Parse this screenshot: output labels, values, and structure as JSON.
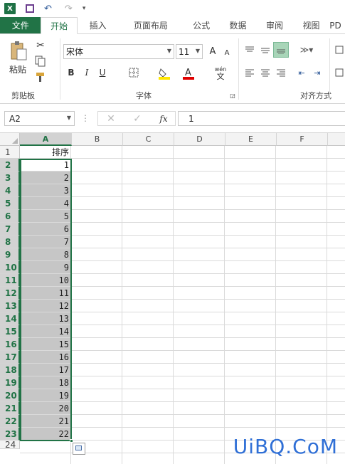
{
  "quick_access": {
    "undo_glyph": "↶",
    "redo_glyph": "↷",
    "more_glyph": "▾"
  },
  "tabs": [
    {
      "label": "文件"
    },
    {
      "label": "开始"
    },
    {
      "label": "插入"
    },
    {
      "label": "页面布局"
    },
    {
      "label": "公式"
    },
    {
      "label": "数据"
    },
    {
      "label": "审阅"
    },
    {
      "label": "视图"
    },
    {
      "label": "PD"
    }
  ],
  "ribbon": {
    "clipboard": {
      "paste_label": "粘贴",
      "group_label": "剪贴板"
    },
    "font": {
      "font_name": "宋体",
      "font_size": "11",
      "group_label": "字体",
      "bold": "B",
      "italic": "I",
      "underline": "U",
      "grow": "A",
      "shrink": "A",
      "phonetic": "wén"
    },
    "alignment": {
      "group_label": "对齐方式"
    }
  },
  "formula_bar": {
    "name_box": "A2",
    "fx": "fx",
    "value": "1"
  },
  "columns": [
    "A",
    "B",
    "C",
    "D",
    "E",
    "F"
  ],
  "rows": [
    "1",
    "2",
    "3",
    "4",
    "5",
    "6",
    "7",
    "8",
    "9",
    "10",
    "11",
    "12",
    "13",
    "14",
    "15",
    "16",
    "17",
    "18",
    "19",
    "20",
    "21",
    "22",
    "23",
    "24"
  ],
  "cells_a": [
    "排序",
    "1",
    "2",
    "3",
    "4",
    "5",
    "6",
    "7",
    "8",
    "9",
    "10",
    "11",
    "12",
    "13",
    "14",
    "15",
    "16",
    "17",
    "18",
    "19",
    "20",
    "21",
    "22"
  ],
  "colors": {
    "accent": "#217346",
    "selection": "#c6c6c6"
  },
  "watermark": "UiBQ.CoM"
}
